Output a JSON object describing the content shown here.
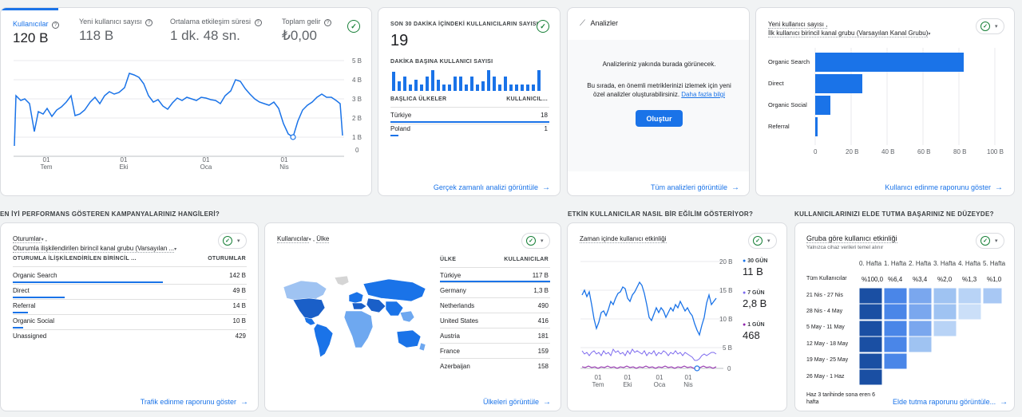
{
  "overview": {
    "metrics": [
      {
        "label": "Kullanıcılar",
        "value": "120 B",
        "active": true
      },
      {
        "label": "Yeni kullanıcı sayısı",
        "value": "118 B",
        "active": false
      },
      {
        "label": "Ortalama etkileşim süresi",
        "value": "1 dk. 48 sn.",
        "active": false
      },
      {
        "label": "Toplam gelir",
        "value": "₺0,00",
        "active": false
      }
    ],
    "yticks": [
      "5 B",
      "4 B",
      "3 B",
      "2 B",
      "1 B",
      "0"
    ],
    "xticks": [
      {
        "day": "01",
        "month": "Tem"
      },
      {
        "day": "01",
        "month": "Eki"
      },
      {
        "day": "01",
        "month": "Oca"
      },
      {
        "day": "01",
        "month": "Nis"
      }
    ]
  },
  "realtime": {
    "title": "SON 30 DAKİKA İÇİNDEKİ KULLANICILARIN SAYISI",
    "value": "19",
    "per_minute_label": "DAKİKA BAŞINA KULLANICI SAYISI",
    "col_country": "BAŞLICA ÜLKELER",
    "col_users": "KULLANICIL...",
    "rows": [
      {
        "country": "Türkiye",
        "value": "18"
      },
      {
        "country": "Poland",
        "value": "1"
      }
    ],
    "footer": "Gerçek zamanlı analizi görüntüle"
  },
  "insights": {
    "title": "Analizler",
    "headline": "Analizleriniz yakında burada görünecek.",
    "body": "Bu sırada, en önemli metriklerinizi izlemek için yeni özel analizler oluşturabilirsiniz.",
    "link": "Daha fazla bilgi",
    "button": "Oluştur",
    "footer": "Tüm analizleri görüntüle"
  },
  "acquisition": {
    "title_line1": "Yeni kullanıcı sayısı ,",
    "title_line2": "İlk kullanıcı birincil kanal grubu (Varsayılan Kanal Grubu)",
    "xticks": [
      "0",
      "20 B",
      "40 B",
      "60 B",
      "80 B",
      "100 B"
    ],
    "footer": "Kullanıcı edinme raporunu göster"
  },
  "sections": {
    "campaigns": "EN İYİ PERFORMANS GÖSTEREN KAMPANYALARINIZ HANGİLERİ?",
    "trend": "ETKİN KULLANICILAR NASIL BİR EĞİLİM GÖSTERİYOR?",
    "retention": "KULLANICILARINIZI ELDE TUTMA BAŞARINIZ NE DÜZEYDE?"
  },
  "sessions": {
    "title_line1": "Oturumlar",
    "title_line2": "Oturumla ilişkilendirilen birincil kanal grubu (Varsayılan ...",
    "col1": "OTURUMLA İLİŞKİLENDİRİLEN BİRİNCİL ...",
    "col2": "OTURUMLAR",
    "rows": [
      {
        "name": "Organic Search",
        "value": "142 B"
      },
      {
        "name": "Direct",
        "value": "49 B"
      },
      {
        "name": "Referral",
        "value": "14 B"
      },
      {
        "name": "Organic Social",
        "value": "10 B"
      },
      {
        "name": "Unassigned",
        "value": "429"
      }
    ],
    "footer": "Trafik edinme raporunu göster"
  },
  "countries": {
    "title_metric": "Kullanıcılar",
    "title_dim": "Ülke",
    "col1": "ÜLKE",
    "col2": "KULLANICILAR",
    "rows": [
      {
        "name": "Türkiye",
        "value": "117 B"
      },
      {
        "name": "Germany",
        "value": "1,3 B"
      },
      {
        "name": "Netherlands",
        "value": "490"
      },
      {
        "name": "United States",
        "value": "416"
      },
      {
        "name": "Austria",
        "value": "181"
      },
      {
        "name": "France",
        "value": "159"
      },
      {
        "name": "Azerbaijan",
        "value": "158"
      }
    ],
    "footer": "Ülkeleri görüntüle"
  },
  "activity": {
    "title": "Zaman içinde kullanıcı etkinliği",
    "yticks": [
      "20 B",
      "15 B",
      "10 B",
      "5 B",
      "0"
    ],
    "xticks": [
      {
        "day": "01",
        "month": "Tem"
      },
      {
        "day": "01",
        "month": "Eki"
      },
      {
        "day": "01",
        "month": "Oca"
      },
      {
        "day": "01",
        "month": "Nis"
      }
    ],
    "legend": [
      {
        "label": "30 GÜN",
        "value": "11 B",
        "color": "#1a73e8"
      },
      {
        "label": "7 GÜN",
        "value": "2,8 B",
        "color": "#7b68ee"
      },
      {
        "label": "1 GÜN",
        "value": "468",
        "color": "#8e24aa"
      }
    ]
  },
  "cohort": {
    "title": "Gruba göre kullanıcı etkinliği",
    "subtitle": "Yalnızca cihaz verileri temel alınır",
    "weeks": [
      "0. Hafta",
      "1. Hafta",
      "2. Hafta",
      "3. Hafta",
      "4. Hafta",
      "5. Hafta"
    ],
    "all_label": "Tüm Kullanıcılar",
    "all_values": [
      "%100,0",
      "%6,4",
      "%3,4",
      "%2,0",
      "%1,3",
      "%1,0"
    ],
    "rows": [
      {
        "label": "21 Nis - 27 Nis",
        "cells": 6
      },
      {
        "label": "28 Nis - 4 May",
        "cells": 5
      },
      {
        "label": "5 May - 11 May",
        "cells": 4
      },
      {
        "label": "12 May - 18 May",
        "cells": 3
      },
      {
        "label": "19 May - 25 May",
        "cells": 2
      },
      {
        "label": "26 May - 1 Haz",
        "cells": 1
      }
    ],
    "note": "Haz 3 tarihinde sona eren 6 hafta",
    "footer": "Elde tutma raporunu görüntüle..."
  },
  "colors": {
    "accent": "#1a73e8",
    "success": "#188038"
  }
}
